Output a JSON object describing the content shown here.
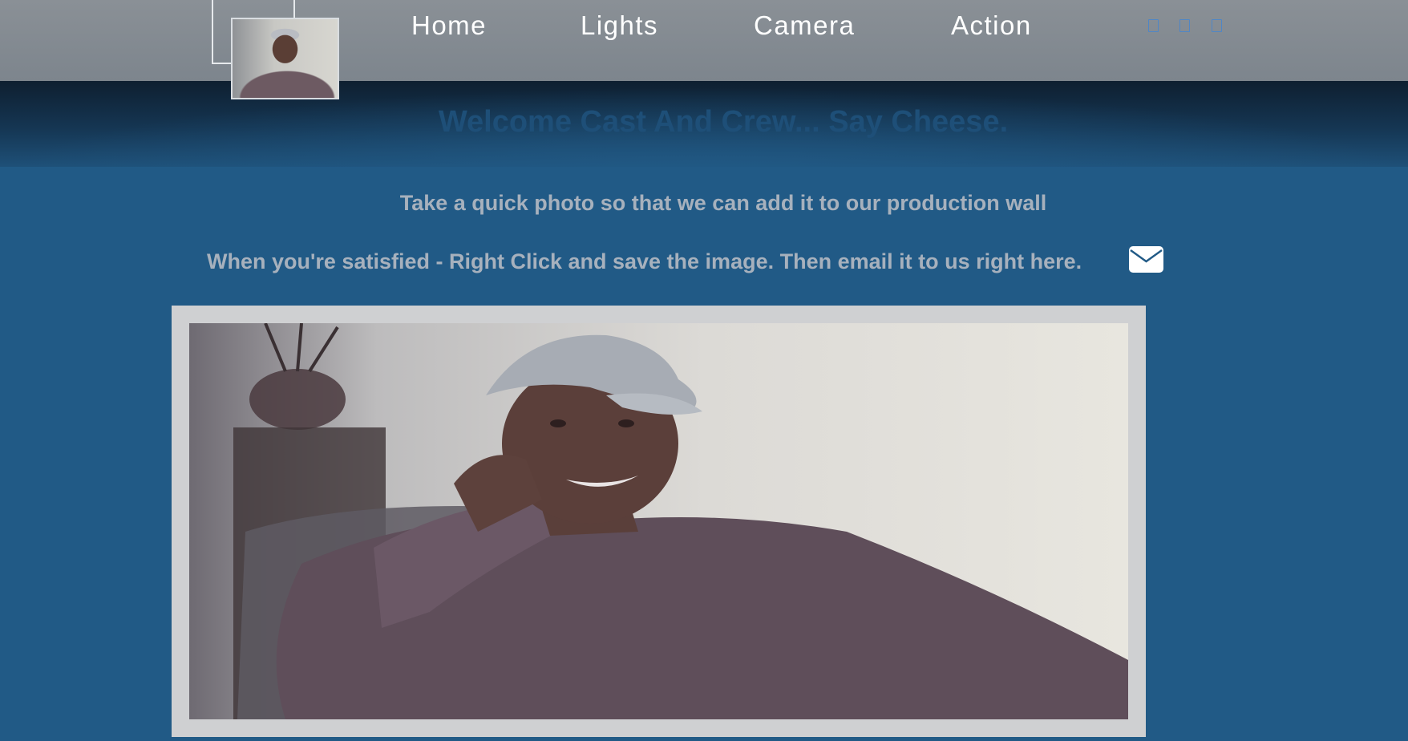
{
  "nav": {
    "items": [
      {
        "label": "Home"
      },
      {
        "label": "Lights"
      },
      {
        "label": "Camera"
      },
      {
        "label": "Action"
      }
    ],
    "social_icons": [
      "social-icon",
      "social-icon",
      "social-icon"
    ]
  },
  "header": {
    "welcome": "Welcome Cast And Crew... Say Cheese."
  },
  "instructions": {
    "line1": "Take a quick photo so that we can add it to our production wall",
    "line2": "When you're satisfied - Right Click and save the image. Then email it to us right here."
  },
  "icons": {
    "email": "envelope-icon"
  },
  "colors": {
    "background": "#215a86",
    "topbar": "#858c93",
    "welcome_text": "#1e4f78",
    "instruction_text": "#a7b1bd",
    "frame": "#cfd0d2"
  }
}
